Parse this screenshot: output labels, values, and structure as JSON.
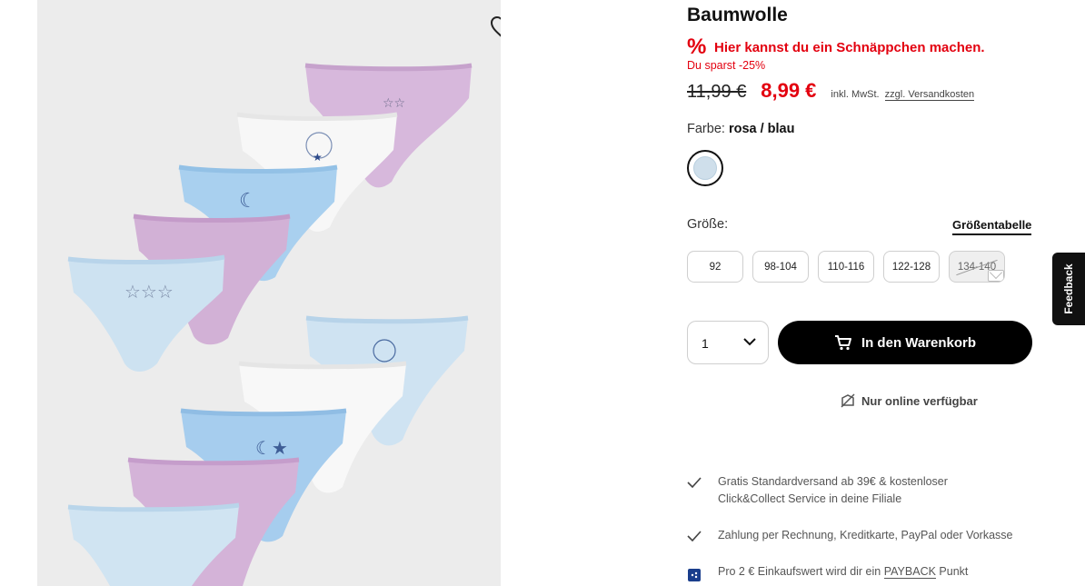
{
  "product": {
    "title": "Baumwolle",
    "deal_icon": "%",
    "deal_text": "Hier kannst du ein Schnäppchen machen.",
    "saving_text": "Du sparst -25%",
    "old_price": "11,99 €",
    "new_price": "8,99 €",
    "tax_text": "inkl. MwSt.",
    "shipping_link": "zzgl. Versandkosten",
    "color_label": "Farbe:",
    "color_value": "rosa / blau",
    "size_label": "Größe:",
    "size_table_link": "Größentabelle",
    "sizes": [
      {
        "label": "92",
        "available": true
      },
      {
        "label": "98-104",
        "available": true
      },
      {
        "label": "110-116",
        "available": true
      },
      {
        "label": "122-128",
        "available": true
      },
      {
        "label": "134-140",
        "available": false
      }
    ],
    "quantity": "1",
    "add_to_cart_label": "In den Warenkorb",
    "online_only_label": "Nur online verfügbar"
  },
  "usps": [
    {
      "icon": "check-icon",
      "lines": [
        "Gratis Standardversand ab 39€ & kostenloser",
        "Click&Collect Service in deine Filiale"
      ]
    },
    {
      "icon": "check-icon",
      "lines": [
        "Zahlung per Rechnung, Kreditkarte, PayPal oder Vorkasse"
      ]
    },
    {
      "icon": "payback-icon",
      "prefix": "Pro 2 € Einkaufswert wird dir ein",
      "link": "PAYBACK",
      "suffix": "Punkt"
    }
  ],
  "feedback_tab": "Feedback",
  "colors": {
    "accent_red": "#e3000f",
    "button_black": "#000000",
    "swatch": "#cfdfeb",
    "image_bg": "#ececec"
  }
}
